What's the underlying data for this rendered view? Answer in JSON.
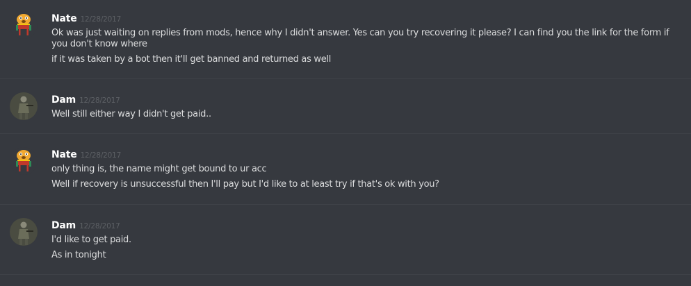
{
  "messages": [
    {
      "username": "Nate",
      "timestamp": "12/28/2017",
      "avatar": "jake-the-dog-avatar",
      "lines": [
        "Ok was just waiting on replies from mods, hence why I didn't answer. Yes can you try recovering it please? I can find you the link for the form if you don't know where",
        "if it was taken by a bot then it'll get banned and returned as well"
      ]
    },
    {
      "username": "Dam",
      "timestamp": "12/28/2017",
      "avatar": "soldier-avatar",
      "lines": [
        "Well still either way I didn't get paid.."
      ]
    },
    {
      "username": "Nate",
      "timestamp": "12/28/2017",
      "avatar": "jake-the-dog-avatar",
      "lines": [
        "only thing is, the name might get bound to ur acc",
        "Well if recovery is unsuccessful then I'll pay but I'd like to at least try if that's ok with you?"
      ]
    },
    {
      "username": "Dam",
      "timestamp": "12/28/2017",
      "avatar": "soldier-avatar",
      "lines": [
        "I'd like to get paid.",
        "As in tonight"
      ]
    }
  ],
  "colors": {
    "background": "#36393f",
    "username": "#ffffff",
    "timestamp": "#5d6065",
    "message_text": "#dcddde",
    "divider": "#3f4248"
  }
}
